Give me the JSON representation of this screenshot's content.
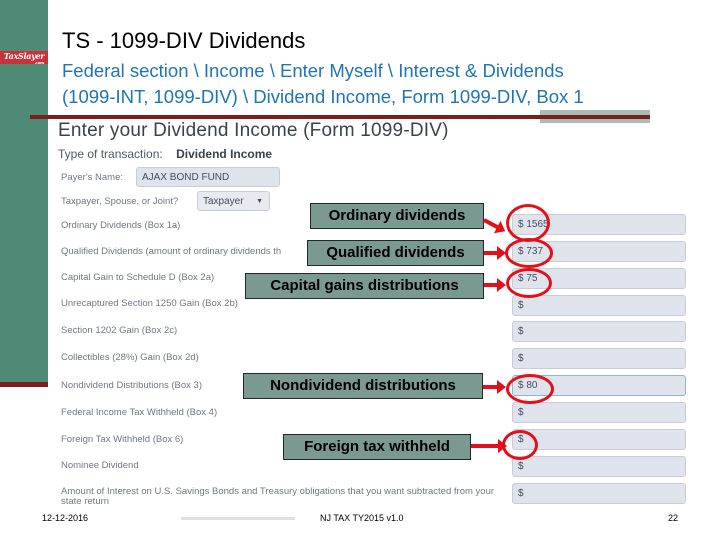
{
  "slide": {
    "title": "TS - 1099-DIV Dividends",
    "subtitle_line1": "Federal section \\ Income \\ Enter Myself \\ Interest & Dividends",
    "subtitle_line2": "(1099-INT, 1099-DIV) \\ Dividend Income, Form 1099-DIV, Box 1",
    "logo_text": "TaxSlayer",
    "logo_suffix": ".com"
  },
  "form": {
    "title": "Enter your Dividend Income (Form 1099-DIV)",
    "type_label": "Type of transaction:",
    "type_value": "Dividend Income",
    "payer_label": "Payer's Name:",
    "payer_value": "AJAX BOND FUND",
    "taxpayer_label": "Taxpayer, Spouse, or Joint?",
    "taxpayer_value": "Taxpayer",
    "fields": [
      {
        "label": "Ordinary Dividends (Box 1a)",
        "value": "$ 1565"
      },
      {
        "label": "Qualified Dividends (amount of ordinary dividends th",
        "value": "$ 737"
      },
      {
        "label": "Capital Gain to Schedule D (Box 2a)",
        "value": "$ 75"
      },
      {
        "label": "Unrecaptured Section 1250 Gain (Box 2b)",
        "value": "$"
      },
      {
        "label": "Section 1202 Gain (Box 2c)",
        "value": "$"
      },
      {
        "label": "Collectibles (28%) Gain (Box 2d)",
        "value": "$"
      },
      {
        "label": "Nondividend Distributions (Box 3)",
        "value": "$ 80"
      },
      {
        "label": "Federal Income Tax Withheld (Box 4)",
        "value": "$"
      },
      {
        "label": "Foreign Tax Withheld (Box 6)",
        "value": "$"
      },
      {
        "label": "Nominee Dividend",
        "value": "$"
      },
      {
        "label": "Amount of Interest on U.S. Savings Bonds and Treasury obligations that you want subtracted from your state return",
        "value": "$"
      }
    ]
  },
  "callouts": [
    {
      "text": "Ordinary dividends",
      "target": "Ordinary Dividends (Box 1a)"
    },
    {
      "text": "Qualified dividends",
      "target": "Qualified Dividends"
    },
    {
      "text": "Capital gains distributions",
      "target": "Capital Gain to Schedule D (Box 2a)"
    },
    {
      "text": "Nondividend distributions",
      "target": "Nondividend Distributions (Box 3)"
    },
    {
      "text": "Foreign tax withheld",
      "target": "Foreign Tax Withheld (Box 6)"
    }
  ],
  "footer": {
    "date": "12-12-2016",
    "center": "NJ TAX TY2015 v1.0",
    "page": "22"
  },
  "colors": {
    "sidebar": "#4f8a76",
    "rule": "#7a1e1e",
    "subtitle": "#1f75b4",
    "callout_bg": "#7a9990",
    "highlight": "#e3101a"
  }
}
